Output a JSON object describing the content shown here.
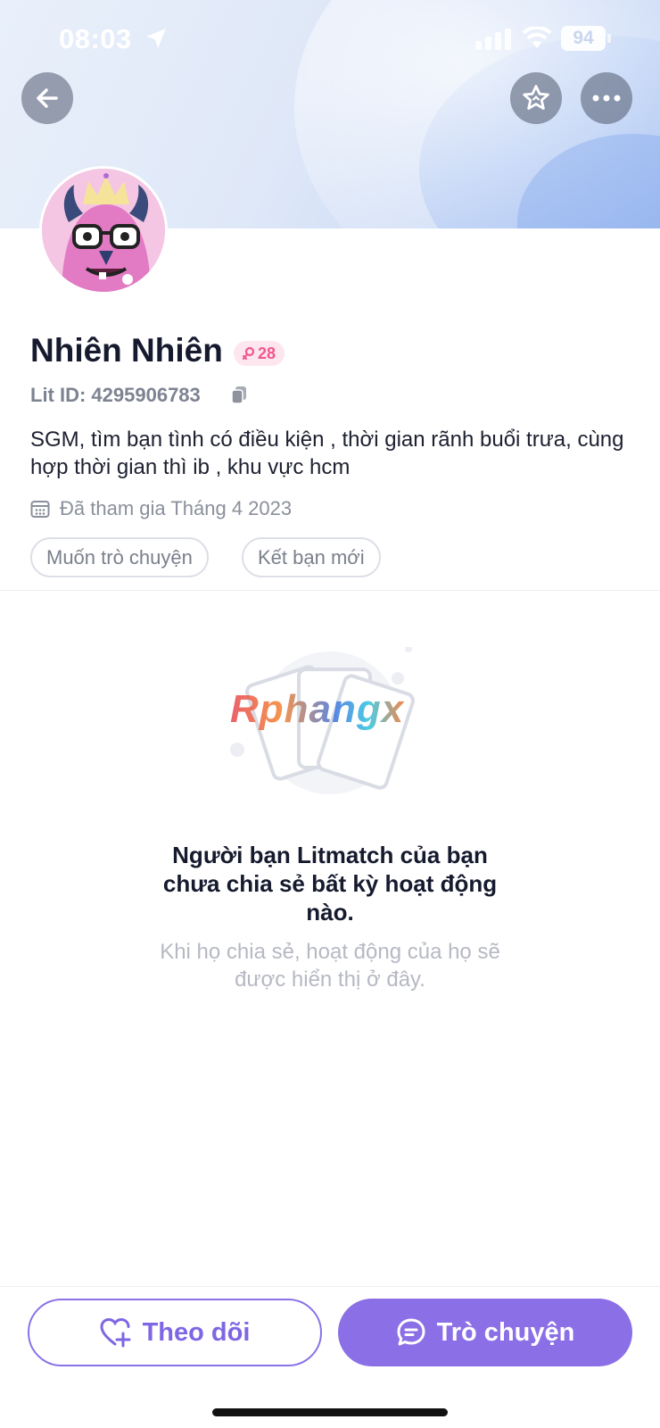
{
  "status_bar": {
    "time": "08:03",
    "battery": "94"
  },
  "profile": {
    "name": "Nhiên Nhiên",
    "badge_value": "28",
    "lit_id": "Lit ID: 4295906783",
    "bio": "SGM, tìm bạn tình có điều kiện , thời gian rãnh buổi trưa, cùng hợp thời gian thì ib , khu vực hcm",
    "joined": "Đã tham gia Tháng 4 2023",
    "tags": [
      "Muốn trò chuyện",
      "Kết bạn mới"
    ]
  },
  "empty_state": {
    "watermark": "Rphangx",
    "title": "Người bạn Litmatch của bạn chưa chia sẻ bất kỳ hoạt động nào.",
    "subtitle": "Khi họ chia sẻ, hoạt động của họ sẽ được hiển thị ở đây."
  },
  "actions": {
    "follow_label": "Theo dõi",
    "chat_label": "Trò chuyện"
  },
  "colors": {
    "accent": "#8b6fe6",
    "badge_pink": "#f0568f"
  },
  "icons": [
    "back-arrow-icon",
    "star-icon",
    "more-icon",
    "copy-icon",
    "calendar-icon",
    "heart-plus-icon",
    "chat-icon"
  ]
}
